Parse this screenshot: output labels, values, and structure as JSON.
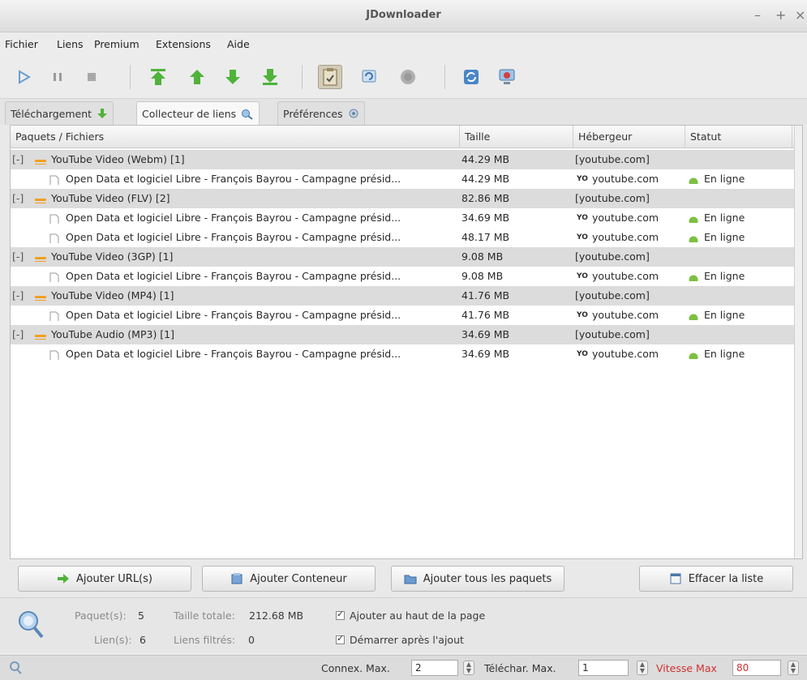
{
  "window": {
    "title": "JDownloader",
    "controls": [
      "–",
      "+",
      "×"
    ]
  },
  "menu": [
    "Fichier",
    "Liens",
    "Premium",
    "Extensions",
    "Aide"
  ],
  "tabs": [
    {
      "label": "Téléchargement"
    },
    {
      "label": "Collecteur de liens"
    },
    {
      "label": "Préférences"
    }
  ],
  "columns": [
    "Paquets / Fichiers",
    "Taille",
    "Hébergeur",
    "Statut"
  ],
  "rows": [
    {
      "type": "package",
      "name": "YouTube Video (Webm) [1]",
      "size": "44.29 MB",
      "host": "[youtube.com]",
      "status": ""
    },
    {
      "type": "file",
      "name": "Open Data et logiciel Libre - François Bayrou - Campagne présid...",
      "size": "44.29 MB",
      "host": "youtube.com",
      "status": "En ligne"
    },
    {
      "type": "package",
      "name": "YouTube Video (FLV) [2]",
      "size": "82.86 MB",
      "host": "[youtube.com]",
      "status": ""
    },
    {
      "type": "file",
      "name": "Open Data et logiciel Libre - François Bayrou - Campagne présid...",
      "size": "34.69 MB",
      "host": "youtube.com",
      "status": "En ligne"
    },
    {
      "type": "file",
      "name": "Open Data et logiciel Libre - François Bayrou - Campagne présid...",
      "size": "48.17 MB",
      "host": "youtube.com",
      "status": "En ligne"
    },
    {
      "type": "package",
      "name": "YouTube Video (3GP) [1]",
      "size": "9.08 MB",
      "host": "[youtube.com]",
      "status": ""
    },
    {
      "type": "file",
      "name": "Open Data et logiciel Libre - François Bayrou - Campagne présid...",
      "size": "9.08 MB",
      "host": "youtube.com",
      "status": "En ligne"
    },
    {
      "type": "package",
      "name": "YouTube Video (MP4) [1]",
      "size": "41.76 MB",
      "host": "[youtube.com]",
      "status": ""
    },
    {
      "type": "file",
      "name": "Open Data et logiciel Libre - François Bayrou - Campagne présid...",
      "size": "41.76 MB",
      "host": "youtube.com",
      "status": "En ligne"
    },
    {
      "type": "package",
      "name": "YouTube Audio (MP3) [1]",
      "size": "34.69 MB",
      "host": "[youtube.com]",
      "status": ""
    },
    {
      "type": "file",
      "name": "Open Data et logiciel Libre - François Bayrou - Campagne présid...",
      "size": "34.69 MB",
      "host": "youtube.com",
      "status": "En ligne"
    }
  ],
  "expand_glyph": "[-]",
  "host_glyph": "YO",
  "buttons": {
    "add_url": "Ajouter URL(s)",
    "add_container": "Ajouter Conteneur",
    "add_all": "Ajouter tous les paquets",
    "clear": "Effacer la liste"
  },
  "stats": {
    "packages_label": "Paquet(s):",
    "packages_value": "5",
    "links_label": "Lien(s):",
    "links_value": "6",
    "total_label": "Taille totale:",
    "total_value": "212.68 MB",
    "filtered_label": "Liens filtrés:",
    "filtered_value": "0",
    "opt_top": "Ajouter au haut de la page",
    "opt_start": "Démarrer après l'ajout"
  },
  "bottom": {
    "conn_label": "Connex. Max.",
    "conn_value": "2",
    "dl_label": "Téléchar. Max.",
    "dl_value": "1",
    "speed_label": "Vitesse Max",
    "speed_value": "80"
  },
  "colors": {
    "pkg_row": "#dcdcdc",
    "online": "#7cc040",
    "arrow_green": "#4fb33a",
    "speed_red": "#d03030"
  }
}
